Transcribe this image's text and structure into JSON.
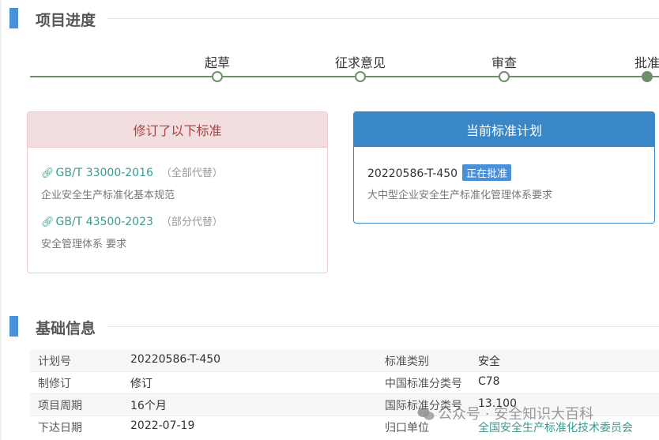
{
  "progress": {
    "title": "项目进度",
    "steps": [
      {
        "label": "起草",
        "active": false
      },
      {
        "label": "征求意见",
        "active": false
      },
      {
        "label": "审查",
        "active": false
      },
      {
        "label": "批准",
        "active": true
      }
    ]
  },
  "revised": {
    "header": "修订了以下标准",
    "items": [
      {
        "code": "GB/T 33000-2016",
        "note": "（全部代替）",
        "desc": "企业安全生产标准化基本规范"
      },
      {
        "code": "GB/T 43500-2023",
        "note": "（部分代替）",
        "desc": "安全管理体系 要求"
      }
    ]
  },
  "current_plan": {
    "header": "当前标准计划",
    "plan_no": "20220586-T-450",
    "status": "正在批准",
    "desc": "大中型企业安全生产标准化管理体系要求"
  },
  "basic": {
    "title": "基础信息",
    "rows": [
      {
        "k1": "计划号",
        "v1": "20220586-T-450",
        "k2": "标准类别",
        "v2": "安全"
      },
      {
        "k1": "制修订",
        "v1": "修订",
        "k2": "中国标准分类号",
        "v2": "C78"
      },
      {
        "k1": "项目周期",
        "v1": "16个月",
        "k2": "国际标准分类号",
        "v2": "13.100"
      },
      {
        "k1": "下达日期",
        "v1": "2022-07-19",
        "k2": "归口单位",
        "v2": "全国安全生产标准化技术委员会"
      }
    ]
  },
  "watermark": "公众号 · 安全知识大百科",
  "colors": {
    "accent": "#4a90d9",
    "track": "#6f8f6a",
    "link": "#3a9a8c",
    "danger_bg": "#f2dede"
  }
}
